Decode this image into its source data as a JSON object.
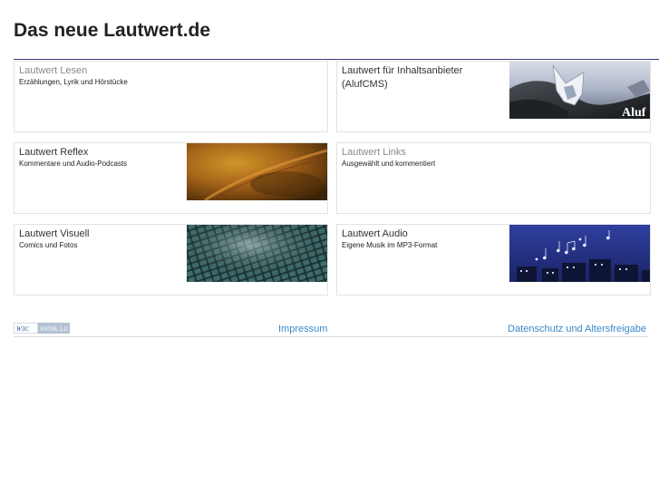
{
  "header": {
    "title": "Das neue Lautwert.de"
  },
  "cards": [
    {
      "title": "Lautwert Lesen",
      "description": "Erzählungen, Lyrik und Hörstücke",
      "image": "none"
    },
    {
      "title": "Lautwert für Inhaltsanbieter (AlufCMS)",
      "description": "",
      "image": "aluf-cms-banner",
      "image_text": "Aluf"
    },
    {
      "title": "Lautwert Reflex",
      "description": "Kommentare und Audio-Podcasts",
      "image": "orange-sky-photo"
    },
    {
      "title": "Lautwert Links",
      "description": "Ausgewählt und kommentiert",
      "image": "none"
    },
    {
      "title": "Lautwert Visuell",
      "description": "Comics und Fotos",
      "image": "cobblestone-photo"
    },
    {
      "title": "Lautwert Audio",
      "description": "Eigene Musik im MP3-Format",
      "image": "night-city-notes"
    }
  ],
  "footer": {
    "badge": {
      "left_text": "W3C",
      "right_text": "XHTML 1.0"
    },
    "links": [
      "Impressum",
      "Datenschutz und Altersfreigabe"
    ]
  },
  "colors": {
    "title_rule": "#3a3a8c",
    "link": "#3a88c8",
    "card_border": "#e2e2e2",
    "audio_sky": "#2a3a8a"
  }
}
